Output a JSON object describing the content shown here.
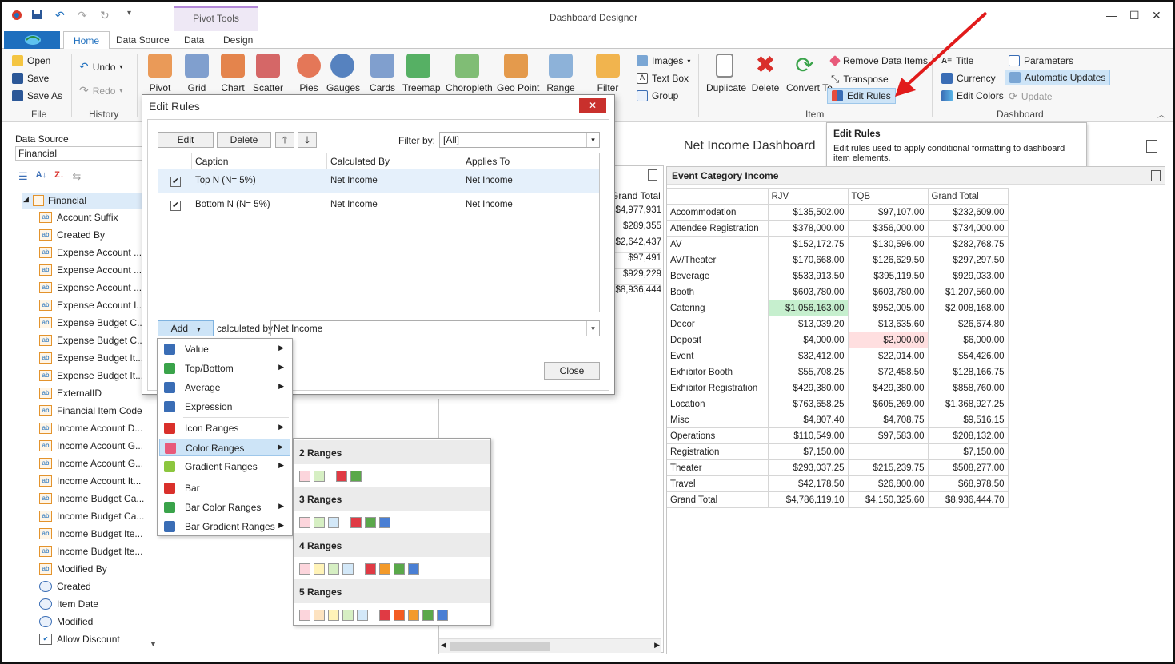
{
  "window": {
    "title": "Dashboard Designer",
    "context_tab": "Pivot Tools"
  },
  "tabs": [
    "Home",
    "Data Source",
    "Data",
    "Design"
  ],
  "ribbon": {
    "file": {
      "open": "Open",
      "save": "Save",
      "save_as": "Save As",
      "label": "File"
    },
    "history": {
      "undo": "Undo",
      "redo": "Redo",
      "label": "History"
    },
    "insert": [
      "Pivot",
      "Grid",
      "Chart",
      "Scatter",
      "Pies",
      "Gauges",
      "Cards",
      "Treemap",
      "Choropleth",
      "Geo Point",
      "Range",
      "Filter"
    ],
    "insert_small": {
      "images": "Images",
      "text_box": "Text Box",
      "group": "Group"
    },
    "item": {
      "duplicate": "Duplicate",
      "delete": "Delete",
      "convert_to": "Convert To",
      "remove_data_items": "Remove Data Items",
      "transpose": "Transpose",
      "edit_rules": "Edit Rules",
      "label": "Item"
    },
    "dashboard": {
      "title": "Title",
      "currency": "Currency",
      "edit_colors": "Edit Colors",
      "parameters": "Parameters",
      "automatic_updates": "Automatic Updates",
      "update": "Update",
      "label": "Dashboard"
    }
  },
  "tooltip": {
    "title": "Edit Rules",
    "text": "Edit rules used to apply conditional formatting to dashboard item elements."
  },
  "left_panel": {
    "label": "Data Source",
    "value": "Financial",
    "root": "Financial",
    "fields": [
      "Account Suffix",
      "Created By",
      "Expense Account ...",
      "Expense Account ...",
      "Expense Account ...",
      "Expense Account I...",
      "Expense Budget C...",
      "Expense Budget C...",
      "Expense Budget It...",
      "Expense Budget It...",
      "ExternalID",
      "Financial Item Code",
      "Income Account D...",
      "Income Account G...",
      "Income Account G...",
      "Income Account It...",
      "Income Budget Ca...",
      "Income Budget Ca...",
      "Income Budget Ite...",
      "Income Budget Ite...",
      "Modified By",
      "Created",
      "Item Date",
      "Modified",
      "Allow Discount"
    ]
  },
  "dashboard": {
    "title": "Net Income Dashboard",
    "bg_grid": {
      "header": "Grand Total",
      "values": [
        "$4,977,931",
        "$289,355",
        "$2,642,437",
        "$97,491",
        "$929,229",
        "$8,936,444"
      ]
    },
    "event_panel": {
      "title": "Event Category Income",
      "columns": [
        "RJV",
        "TQB",
        "Grand Total"
      ],
      "rows": [
        [
          "Accommodation",
          "$135,502.00",
          "$97,107.00",
          "$232,609.00"
        ],
        [
          "Attendee Registration",
          "$378,000.00",
          "$356,000.00",
          "$734,000.00"
        ],
        [
          "AV",
          "$152,172.75",
          "$130,596.00",
          "$282,768.75"
        ],
        [
          "AV/Theater",
          "$170,668.00",
          "$126,629.50",
          "$297,297.50"
        ],
        [
          "Beverage",
          "$533,913.50",
          "$395,119.50",
          "$929,033.00"
        ],
        [
          "Booth",
          "$603,780.00",
          "$603,780.00",
          "$1,207,560.00"
        ],
        [
          "Catering",
          "$1,056,163.00",
          "$952,005.00",
          "$2,008,168.00"
        ],
        [
          "Decor",
          "$13,039.20",
          "$13,635.60",
          "$26,674.80"
        ],
        [
          "Deposit",
          "$4,000.00",
          "$2,000.00",
          "$6,000.00"
        ],
        [
          "Event",
          "$32,412.00",
          "$22,014.00",
          "$54,426.00"
        ],
        [
          "Exhibitor Booth",
          "$55,708.25",
          "$72,458.50",
          "$128,166.75"
        ],
        [
          "Exhibitor Registration",
          "$429,380.00",
          "$429,380.00",
          "$858,760.00"
        ],
        [
          "Location",
          "$763,658.25",
          "$605,269.00",
          "$1,368,927.25"
        ],
        [
          "Misc",
          "$4,807.40",
          "$4,708.75",
          "$9,516.15"
        ],
        [
          "Operations",
          "$110,549.00",
          "$97,583.00",
          "$208,132.00"
        ],
        [
          "Registration",
          "$7,150.00",
          "",
          "$7,150.00"
        ],
        [
          "Theater",
          "$293,037.25",
          "$215,239.75",
          "$508,277.00"
        ],
        [
          "Travel",
          "$42,178.50",
          "$26,800.00",
          "$68,978.50"
        ],
        [
          "Grand Total",
          "$4,786,119.10",
          "$4,150,325.60",
          "$8,936,444.70"
        ]
      ]
    }
  },
  "dialog": {
    "title": "Edit Rules",
    "close_x": "✕",
    "edit": "Edit",
    "delete": "Delete",
    "filter_label": "Filter by:",
    "filter_value": "[All]",
    "columns": [
      "Caption",
      "Calculated By",
      "Applies To"
    ],
    "rules": [
      {
        "caption": "Top N (N= 5%)",
        "calculated_by": "Net Income",
        "applies_to": "Net Income"
      },
      {
        "caption": "Bottom N (N= 5%)",
        "calculated_by": "Net Income",
        "applies_to": "Net Income"
      }
    ],
    "add": "Add",
    "calculated_by_label": "calculated by",
    "calculated_by_value": "Net Income",
    "close": "Close"
  },
  "add_menu": [
    "Value",
    "Top/Bottom",
    "Average",
    "Expression",
    "Icon Ranges",
    "Color Ranges",
    "Gradient Ranges",
    "Bar",
    "Bar Color Ranges",
    "Bar Gradient Ranges"
  ],
  "color_ranges_menu": [
    "2 Ranges",
    "3 Ranges",
    "4 Ranges",
    "5 Ranges"
  ],
  "colors": {
    "accent": "#1e6fbe",
    "highlight_green": "#c6efce",
    "highlight_red": "#ffdfe0",
    "arrow": "#e11b1b"
  }
}
